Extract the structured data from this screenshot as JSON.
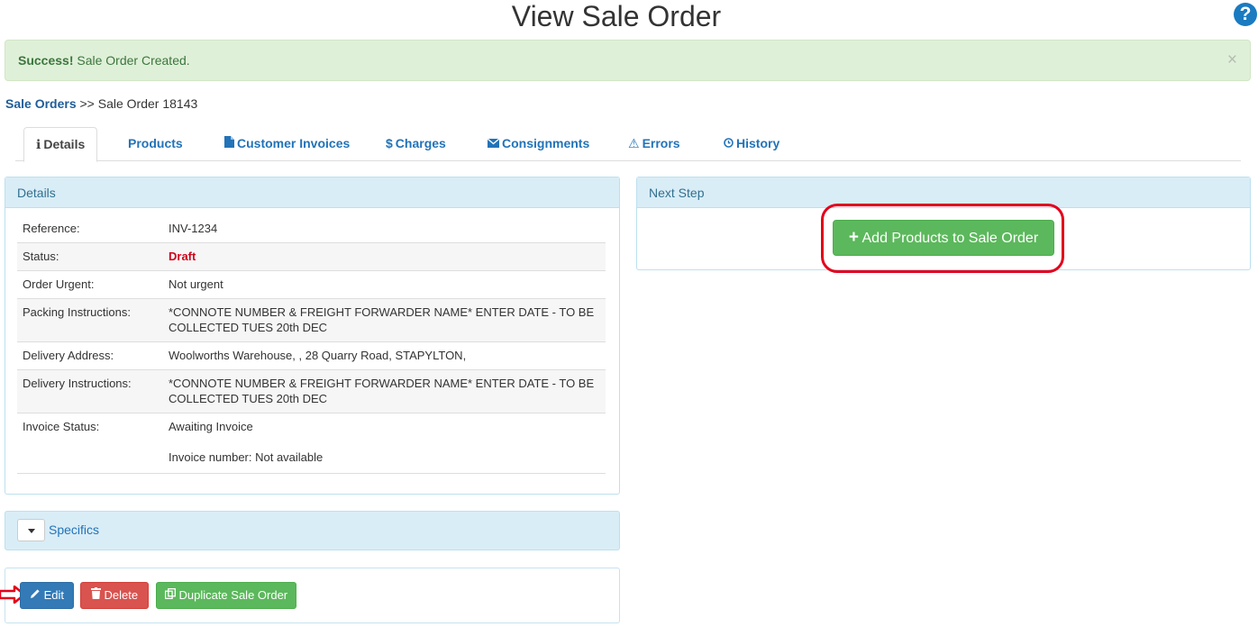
{
  "page": {
    "title": "View Sale Order"
  },
  "help": {
    "glyph": "?"
  },
  "alert": {
    "strong": "Success!",
    "message": " Sale Order Created.",
    "close": "×"
  },
  "breadcrumb": {
    "link": "Sale Orders",
    "separator": " >> ",
    "current": "Sale Order 18143"
  },
  "tabs": [
    {
      "label": "Details",
      "icon": "info-icon",
      "glyph": "ℹ"
    },
    {
      "label": "Products"
    },
    {
      "label": "Customer Invoices",
      "icon": "file-icon"
    },
    {
      "label": "Charges",
      "icon": "dollar-icon",
      "glyph": "$"
    },
    {
      "label": "Consignments",
      "icon": "envelope-icon"
    },
    {
      "label": "Errors",
      "icon": "warning-icon",
      "glyph": "⚠"
    },
    {
      "label": "History",
      "icon": "clock-icon"
    }
  ],
  "details": {
    "heading": "Details",
    "rows": [
      {
        "label": "Reference:",
        "value": "INV-1234"
      },
      {
        "label": "Status:",
        "value": "Draft"
      },
      {
        "label": "Order Urgent:",
        "value": "Not urgent"
      },
      {
        "label": "Packing Instructions:",
        "value": "*CONNOTE NUMBER & FREIGHT FORWARDER NAME* ENTER DATE - TO BE COLLECTED TUES 20th DEC"
      },
      {
        "label": "Delivery Address:",
        "value": "Woolworths Warehouse, , 28 Quarry Road, STAPYLTON,"
      },
      {
        "label": "Delivery Instructions:",
        "value": "*CONNOTE NUMBER & FREIGHT FORWARDER NAME* ENTER DATE - TO BE COLLECTED TUES 20th DEC"
      },
      {
        "label": "Invoice Status:",
        "value": "Awaiting Invoice",
        "extra": "Invoice number: Not available"
      }
    ]
  },
  "next_step": {
    "heading": "Next Step",
    "button": "Add Products to Sale Order",
    "button_icon": "plus-icon",
    "glyph": "+"
  },
  "specifics": {
    "label": "Specifics",
    "icon": "caret-down-icon"
  },
  "actions": {
    "edit": "Edit",
    "edit_icon": "pencil-icon",
    "delete": "Delete",
    "delete_icon": "trash-icon",
    "duplicate": "Duplicate Sale Order",
    "duplicate_icon": "copy-icon"
  },
  "colors": {
    "primary": "#337ab7",
    "success": "#5cb85c",
    "danger": "#d9534f",
    "panel_heading": "#d9edf7",
    "alert_bg": "#dff0d8",
    "highlight": "#e3001b",
    "draft": "#d0021b"
  }
}
